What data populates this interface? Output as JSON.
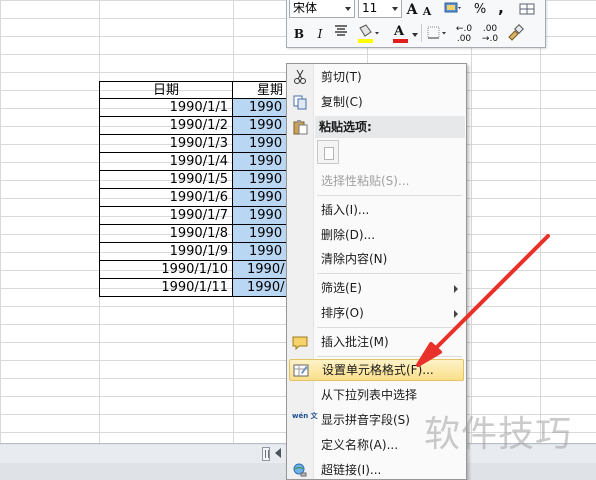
{
  "sheet": {
    "header_date": "日期",
    "header_week": "星期",
    "rows": [
      {
        "date": "1990/1/1",
        "week": "1990"
      },
      {
        "date": "1990/1/2",
        "week": "1990"
      },
      {
        "date": "1990/1/3",
        "week": "1990"
      },
      {
        "date": "1990/1/4",
        "week": "1990"
      },
      {
        "date": "1990/1/5",
        "week": "1990"
      },
      {
        "date": "1990/1/6",
        "week": "1990"
      },
      {
        "date": "1990/1/7",
        "week": "1990"
      },
      {
        "date": "1990/1/8",
        "week": "1990"
      },
      {
        "date": "1990/1/9",
        "week": "1990"
      },
      {
        "date": "1990/1/10",
        "week": "1990/"
      },
      {
        "date": "1990/1/11",
        "week": "1990/"
      }
    ]
  },
  "mini_toolbar": {
    "font_name": "宋体",
    "font_size": "11",
    "grow_font": "A",
    "shrink_font": "A",
    "percent": "%",
    "comma": ",",
    "bold": "B",
    "italic": "I",
    "font_color_letter": "A",
    "inc_decimal": "←.0 .00",
    "dec_decimal": ".00 →.0"
  },
  "context_menu": {
    "items": [
      {
        "label": "剪切(T)",
        "icon": "scissors-icon"
      },
      {
        "label": "复制(C)",
        "icon": "copy-icon"
      },
      {
        "label": "粘贴选项:",
        "icon": "paste-icon"
      },
      {
        "label": "选择性粘贴(S)...",
        "icon": ""
      },
      {
        "label": "插入(I)...",
        "icon": ""
      },
      {
        "label": "删除(D)...",
        "icon": ""
      },
      {
        "label": "清除内容(N)",
        "icon": ""
      },
      {
        "label": "筛选(E)",
        "icon": ""
      },
      {
        "label": "排序(O)",
        "icon": ""
      },
      {
        "label": "插入批注(M)",
        "icon": "comment-icon"
      },
      {
        "label": "设置单元格格式(F)...",
        "icon": "format-cells-icon"
      },
      {
        "label": "从下拉列表中选择",
        "icon": ""
      },
      {
        "label": "显示拼音字段(S)",
        "icon": "phonetic-icon"
      },
      {
        "label": "定义名称(A)...",
        "icon": ""
      },
      {
        "label": "超链接(I)...",
        "icon": "hyperlink-icon"
      }
    ],
    "phonetic_icon_text": "wén 文"
  },
  "annotation": {
    "arrow_color": "#e8312a"
  },
  "watermark": "软件技巧",
  "colors": {
    "selection": "#b9d6f2",
    "menu_highlight": "#fbe08a"
  }
}
